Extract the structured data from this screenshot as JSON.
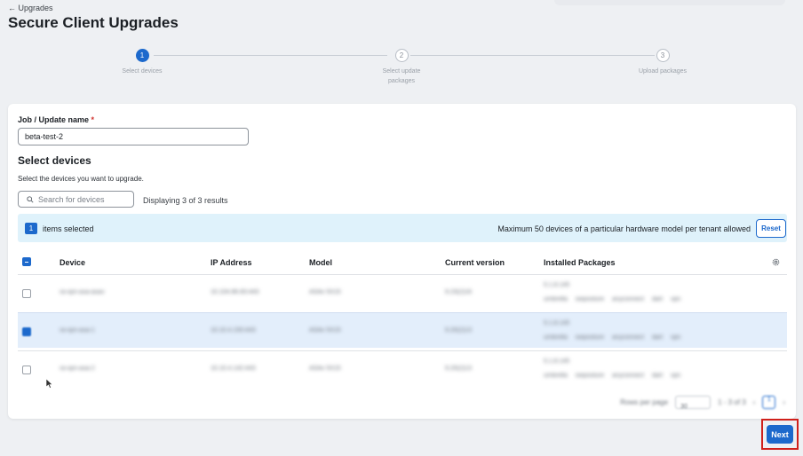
{
  "header": {
    "back_label": "← Upgrades",
    "title": "Secure Client Upgrades"
  },
  "stepper": {
    "steps": [
      {
        "number": "1",
        "label": "Select devices",
        "state": "active"
      },
      {
        "number": "2",
        "label": "Select update packages",
        "state": "pending"
      },
      {
        "number": "3",
        "label": "Upload packages",
        "state": "pending"
      }
    ]
  },
  "form": {
    "job_label": "Job / Update name",
    "required_mark": "*",
    "job_value": "beta-test-2"
  },
  "devices": {
    "title": "Select devices",
    "description": "Select the devices you want to upgrade.",
    "search_placeholder": "Search for devices",
    "result_count": "Displaying 3 of 3 results"
  },
  "selection": {
    "count": "1",
    "text": "items selected",
    "max_notice": "Maximum 50 devices of a particular hardware model per tenant allowed",
    "reset_label": "Reset"
  },
  "table": {
    "columns": [
      "Device",
      "IP Address",
      "Model",
      "Current version",
      "Installed Packages"
    ],
    "rows": [
      {
        "selected": false,
        "device": "ra-vpn-asa-asav",
        "ip": "10.104.86.83:443",
        "model": "ASAv 5X15",
        "version": "9.23(2)16",
        "pkg_version": "5.1.8.145",
        "pkgs": [
          "umbrella",
          "iseposture",
          "anyconnect",
          "dart",
          "vpn"
        ]
      },
      {
        "selected": true,
        "device": "ra-vpn-asa-1",
        "ip": "10.10.4.150:443",
        "model": "ASAv 5X15",
        "version": "9.20(2)13",
        "pkg_version": "5.1.8.145",
        "pkgs": [
          "umbrella",
          "iseposture",
          "anyconnect",
          "dart",
          "vpn"
        ]
      },
      {
        "selected": false,
        "device": "ra-vpn-asa-2",
        "ip": "10.10.4.142:443",
        "model": "ASAv 5X15",
        "version": "9.20(2)13",
        "pkg_version": "5.1.8.145",
        "pkgs": [
          "umbrella",
          "iseposture",
          "anyconnect",
          "dart",
          "vpn"
        ]
      }
    ]
  },
  "pagination": {
    "rows_per_page_label": "Rows per page",
    "rows_per_page_value": "30",
    "range": "1 - 3 of 3",
    "page": "1"
  },
  "footer": {
    "next_label": "Next"
  },
  "colors": {
    "accent": "#1d69cc",
    "banner_bg": "#dff2fb",
    "selected_row_bg": "#e3eefb",
    "highlight": "#d0201b"
  }
}
